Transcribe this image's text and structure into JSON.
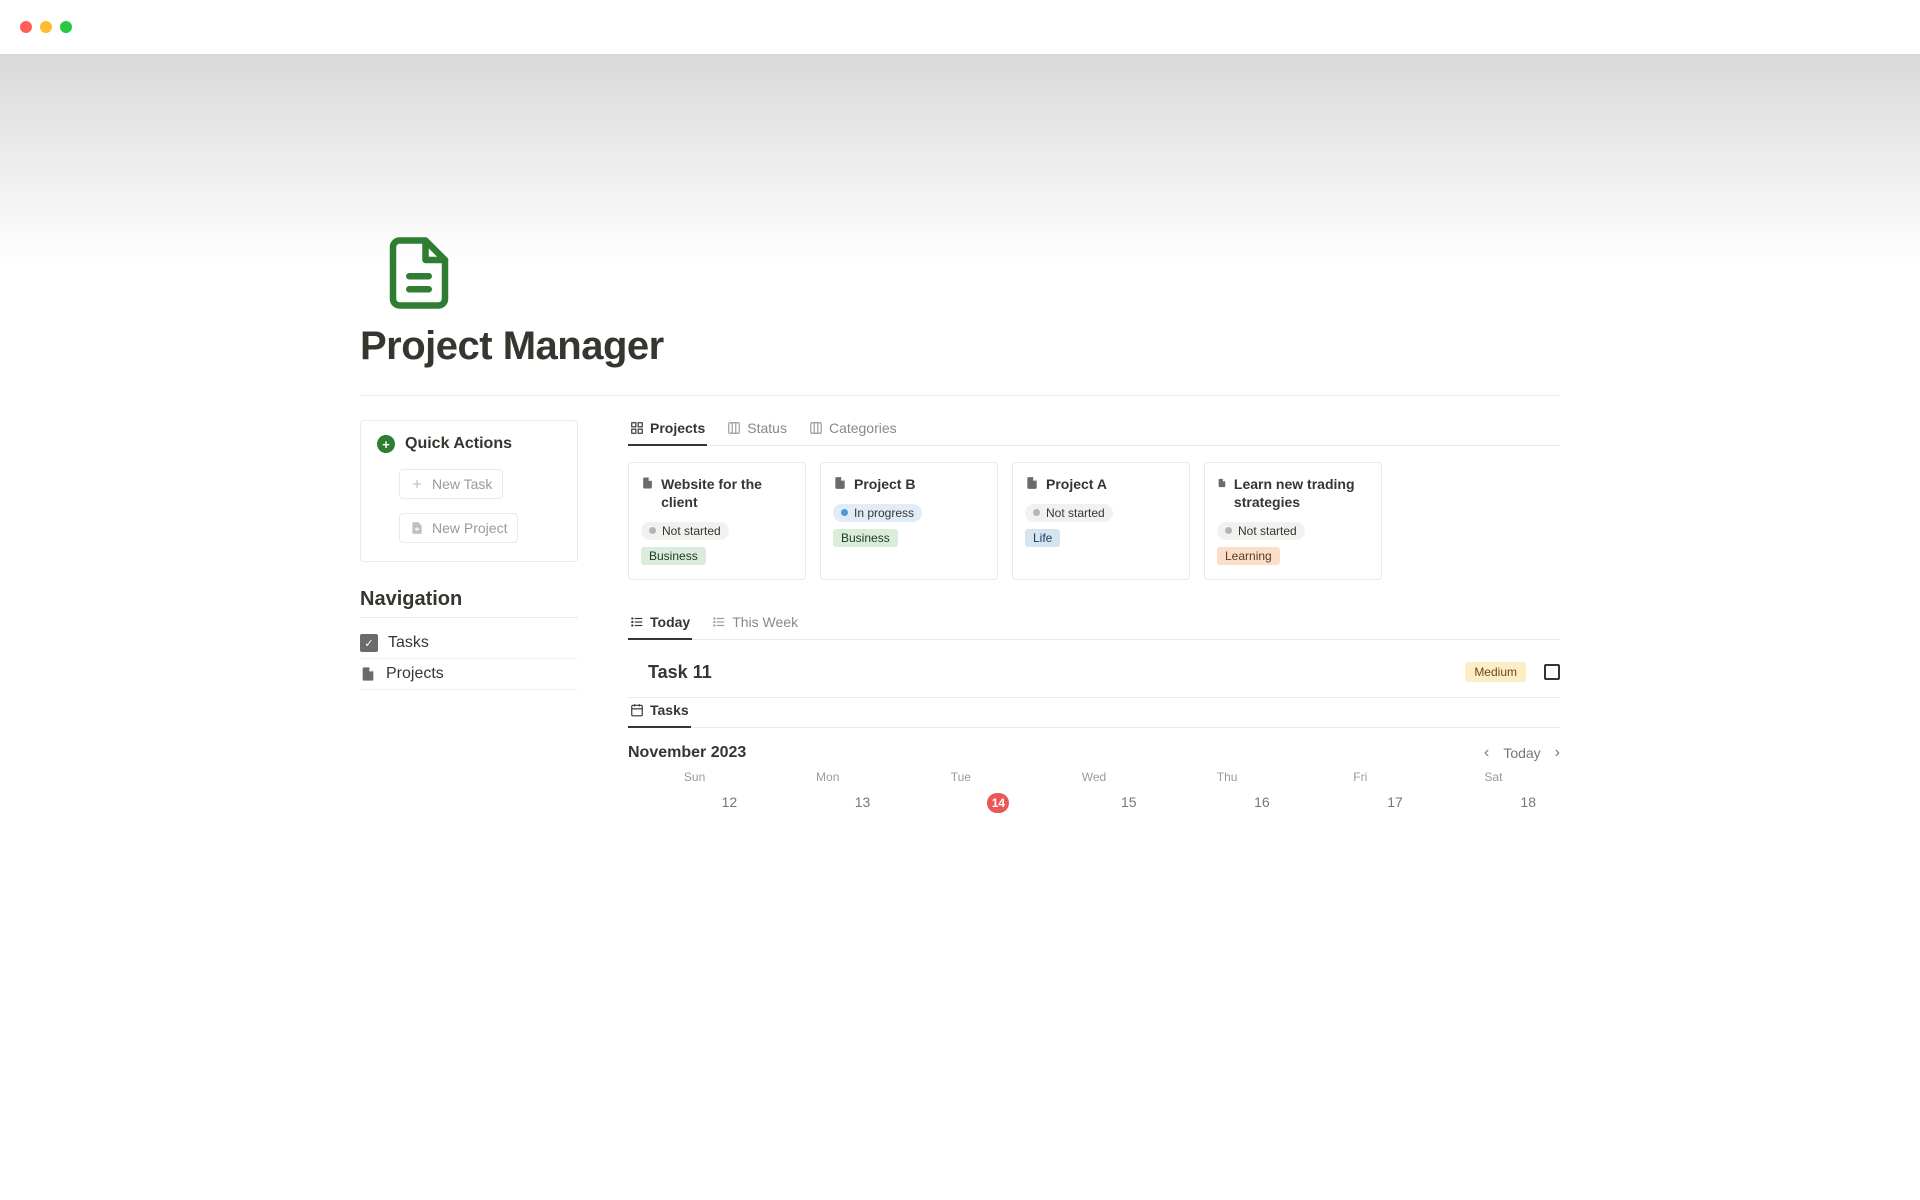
{
  "page": {
    "title": "Project Manager"
  },
  "quickActions": {
    "heading": "Quick Actions",
    "newTask": "New Task",
    "newProject": "New Project"
  },
  "navigation": {
    "heading": "Navigation",
    "tasks": "Tasks",
    "projects": "Projects"
  },
  "projectTabs": {
    "projects": "Projects",
    "status": "Status",
    "categories": "Categories"
  },
  "projects": [
    {
      "title": "Website for the client",
      "status": "Not started",
      "statusKind": "grey",
      "tag": "Business",
      "tagClass": "tag-business"
    },
    {
      "title": "Project B",
      "status": "In progress",
      "statusKind": "blue",
      "tag": "Business",
      "tagClass": "tag-business"
    },
    {
      "title": "Project A",
      "status": "Not started",
      "statusKind": "grey",
      "tag": "Life",
      "tagClass": "tag-life"
    },
    {
      "title": "Learn new trading strategies",
      "status": "Not started",
      "statusKind": "grey",
      "tag": "Learning",
      "tagClass": "tag-learning"
    }
  ],
  "taskTabs": {
    "today": "Today",
    "thisWeek": "This Week"
  },
  "task": {
    "name": "Task 11",
    "priority": "Medium"
  },
  "calendarTab": {
    "tasks": "Tasks"
  },
  "calendar": {
    "monthLabel": "November 2023",
    "todayLabel": "Today",
    "days": [
      "Sun",
      "Mon",
      "Tue",
      "Wed",
      "Thu",
      "Fri",
      "Sat"
    ],
    "dates": [
      "12",
      "13",
      "14",
      "15",
      "16",
      "17",
      "18"
    ],
    "todayIndex": 2
  }
}
